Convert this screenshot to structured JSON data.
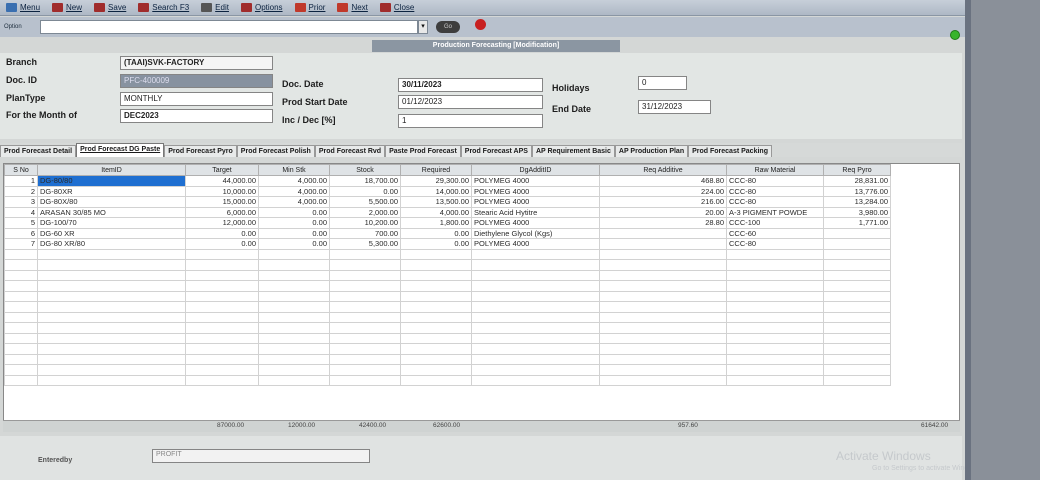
{
  "toolbar": {
    "items": [
      {
        "label": "Menu",
        "icon": "menu-icon",
        "color": "#3a6fb0"
      },
      {
        "label": "New",
        "icon": "new-doc-icon",
        "color": "#a02c2c"
      },
      {
        "label": "Save",
        "icon": "save-icon",
        "color": "#a02c2c"
      },
      {
        "label": "Search F3",
        "icon": "search-icon",
        "color": "#a02c2c"
      },
      {
        "label": "Edit",
        "icon": "edit-icon",
        "color": "#555"
      },
      {
        "label": "Options",
        "icon": "options-icon",
        "color": "#a02c2c"
      },
      {
        "label": "Prior",
        "icon": "prior-arrow-icon",
        "color": "#c0392b"
      },
      {
        "label": "Next",
        "icon": "next-arrow-icon",
        "color": "#c0392b"
      },
      {
        "label": "Close",
        "icon": "close-icon",
        "color": "#a02c2c"
      }
    ]
  },
  "options": {
    "label": "Option",
    "go_label": "Go"
  },
  "banner": "Production Forecasting [Modification]",
  "form": {
    "branch_label": "Branch",
    "branch": "(TAAI)SVK-FACTORY",
    "docid_label": "Doc. ID",
    "docid": "PFC-400009",
    "plantype_label": "PlanType",
    "plantype": "MONTHLY",
    "month_label": "For the Month of",
    "month": "DEC2023",
    "docdate_label": "Doc. Date",
    "docdate": "30/11/2023",
    "startdate_label": "Prod Start Date",
    "startdate": "01/12/2023",
    "incdec_label": "Inc / Dec [%]",
    "incdec": "1",
    "holidays_label": "Holidays",
    "holidays": "0",
    "enddate_label": "End Date",
    "enddate": "31/12/2023"
  },
  "tabs": [
    "Prod Forecast Detail",
    "Prod Forecast DG Paste",
    "Prod Forecast Pyro",
    "Prod Forecast Polish",
    "Prod Forecast Rvd",
    "Paste Prod Forecast",
    "Prod Forecast APS",
    "AP Requirement Basic",
    "AP Production Plan",
    "Prod Forecast Packing"
  ],
  "columns": [
    "S No",
    "ItemID",
    "Target",
    "Min Stk",
    "Stock",
    "Required",
    "DgAdditID",
    "Req Additive",
    "Raw Material",
    "Req Pyro"
  ],
  "rows": [
    {
      "sno": "1",
      "item": "DG-80/80",
      "target": "44,000.00",
      "minstk": "4,000.00",
      "stock": "18,700.00",
      "required": "29,300.00",
      "addit": "POLYMEG 4000",
      "reqadd": "468.80",
      "raw": "CCC-80",
      "pyro": "28,831.00"
    },
    {
      "sno": "2",
      "item": "DG-80XR",
      "target": "10,000.00",
      "minstk": "4,000.00",
      "stock": "0.00",
      "required": "14,000.00",
      "addit": "POLYMEG 4000",
      "reqadd": "224.00",
      "raw": "CCC-80",
      "pyro": "13,776.00"
    },
    {
      "sno": "3",
      "item": "DG-80X/80",
      "target": "15,000.00",
      "minstk": "4,000.00",
      "stock": "5,500.00",
      "required": "13,500.00",
      "addit": "POLYMEG 4000",
      "reqadd": "216.00",
      "raw": "CCC-80",
      "pyro": "13,284.00"
    },
    {
      "sno": "4",
      "item": "ARASAN 30/85 MO",
      "target": "6,000.00",
      "minstk": "0.00",
      "stock": "2,000.00",
      "required": "4,000.00",
      "addit": "Stearic Acid Hytitre",
      "reqadd": "20.00",
      "raw": "A-3 PIGMENT POWDE",
      "pyro": "3,980.00"
    },
    {
      "sno": "5",
      "item": "DG-100/70",
      "target": "12,000.00",
      "minstk": "0.00",
      "stock": "10,200.00",
      "required": "1,800.00",
      "addit": "POLYMEG 4000",
      "reqadd": "28.80",
      "raw": "CCC-100",
      "pyro": "1,771.00"
    },
    {
      "sno": "6",
      "item": "DG-60 XR",
      "target": "0.00",
      "minstk": "0.00",
      "stock": "700.00",
      "required": "0.00",
      "addit": "Diethylene Glycol (Kgs)",
      "reqadd": "",
      "raw": "CCC-60",
      "pyro": ""
    },
    {
      "sno": "7",
      "item": "DG-80 XR/80",
      "target": "0.00",
      "minstk": "0.00",
      "stock": "5,300.00",
      "required": "0.00",
      "addit": "POLYMEG 4000",
      "reqadd": "",
      "raw": "CCC-80",
      "pyro": ""
    }
  ],
  "totals": {
    "target": "87000.00",
    "minstk": "12000.00",
    "stock": "42400.00",
    "required": "62600.00",
    "reqadd": "957.60",
    "pyro": "61642.00"
  },
  "footer": {
    "entered_label": "Enteredby",
    "entered": "PROFIT"
  },
  "watermark": {
    "line1": "Activate Windows",
    "line2": "Go to Settings to activate Windows."
  }
}
